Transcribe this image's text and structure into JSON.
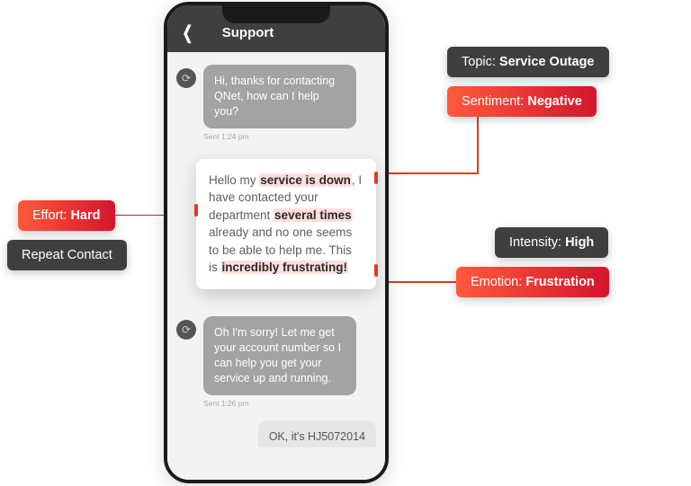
{
  "nav": {
    "title": "Support"
  },
  "messages": {
    "agent1": "Hi, thanks for contacting QNet, how can I help you?",
    "agent1_ts": "Sent 1:24 pm",
    "user1_pre": "Hello my ",
    "user1_hl1": "service is down",
    "user1_mid1": ", I have contacted your department ",
    "user1_hl2": "several times",
    "user1_mid2": " already and no one seems to be able to help me. This is ",
    "user1_hl3": "incredibly frustrating!",
    "agent2": "Oh I'm sorry! Let me get your account number so I can help you get your service up and running.",
    "agent2_ts": "Sent 1:26 pm",
    "user2": "OK, it's HJ5072014"
  },
  "tags": {
    "topic_label": "Topic: ",
    "topic_value": "Service Outage",
    "sentiment_label": "Sentiment: ",
    "sentiment_value": "Negative",
    "intensity_label": "Intensity: ",
    "intensity_value": "High",
    "emotion_label": "Emotion: ",
    "emotion_value": "Frustration",
    "effort_label": "Effort: ",
    "effort_value": "Hard",
    "repeat": "Repeat Contact"
  }
}
